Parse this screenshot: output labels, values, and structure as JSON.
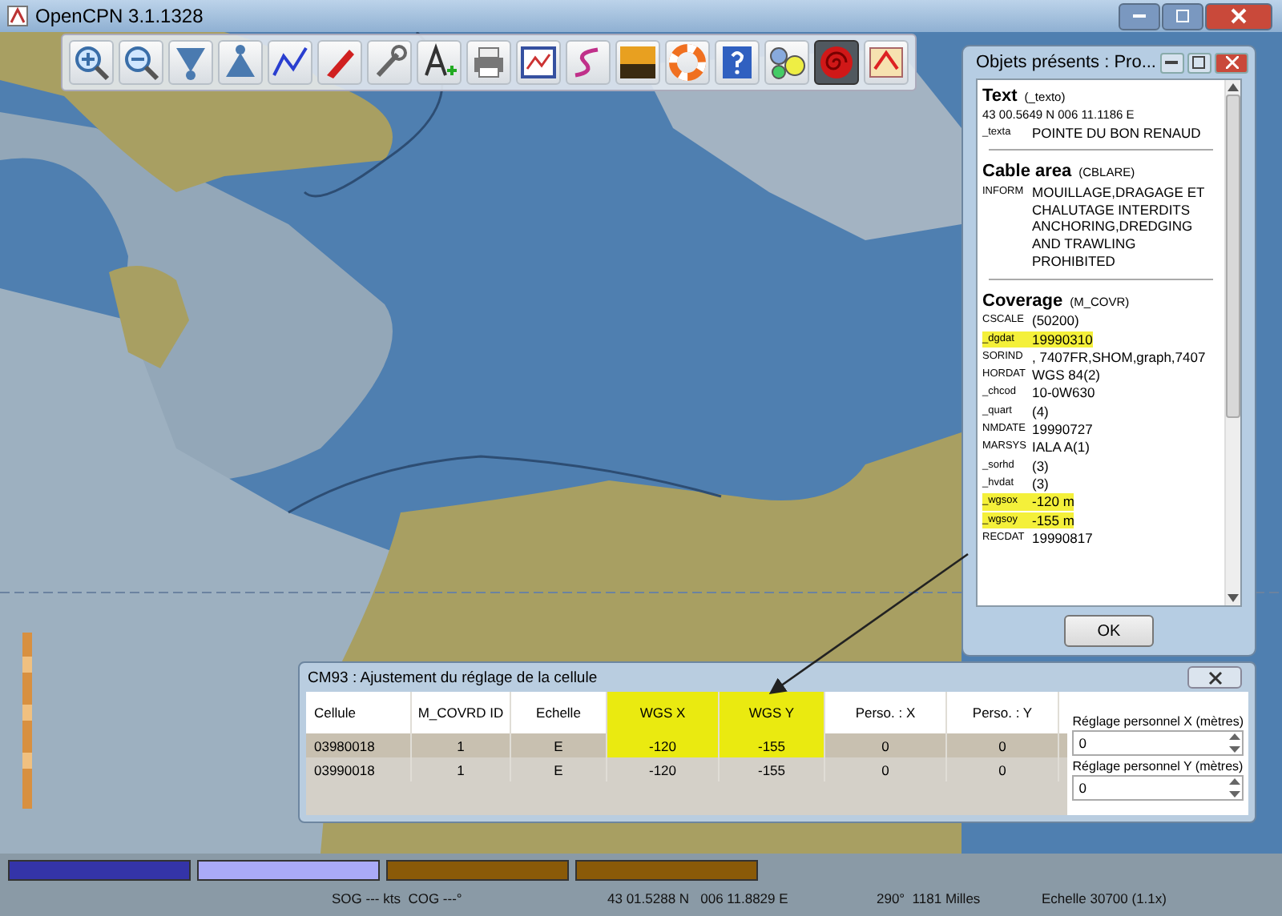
{
  "window": {
    "title": "OpenCPN 3.1.1328"
  },
  "toolbar": [
    {
      "selected": false
    },
    {
      "selected": false
    },
    {
      "selected": false
    },
    {
      "selected": false
    },
    {
      "selected": false
    },
    {
      "selected": false
    },
    {
      "selected": false
    },
    {
      "selected": false
    },
    {
      "selected": false
    },
    {
      "selected": false
    },
    {
      "selected": false
    },
    {
      "selected": false
    },
    {
      "selected": false
    },
    {
      "selected": false
    },
    {
      "selected": false
    },
    {
      "selected": true
    },
    {
      "selected": false
    }
  ],
  "objects_window": {
    "title": "Objets présents : Pro...",
    "sections": [
      {
        "name": "Text",
        "code": "(_texto)",
        "position": "43 00.5649 N 006 11.1186 E",
        "rows": [
          {
            "key": "_texta",
            "value": "POINTE DU BON RENAUD",
            "highlighted": false
          }
        ]
      },
      {
        "name": "Cable area",
        "code": "(CBLARE)",
        "rows": [
          {
            "key": "INFORM",
            "value": "MOUILLAGE,DRAGAGE ET CHALUTAGE INTERDITS ANCHORING,DREDGING AND TRAWLING PROHIBITED",
            "highlighted": false
          }
        ]
      },
      {
        "name": "Coverage",
        "code": "(M_COVR)",
        "rows": [
          {
            "key": "CSCALE",
            "value": "(50200)",
            "highlighted": false
          },
          {
            "key": "_dgdat",
            "value": "19990310",
            "highlighted": true
          },
          {
            "key": "SORIND",
            "value": ", 7407FR,SHOM,graph,7407",
            "highlighted": false
          },
          {
            "key": "HORDAT",
            "value": "WGS 84(2)",
            "highlighted": false
          },
          {
            "key": "_chcod",
            "value": "10-0W630",
            "highlighted": false
          },
          {
            "key": "_quart",
            "value": "(4)",
            "highlighted": false
          },
          {
            "key": "NMDATE",
            "value": "19990727",
            "highlighted": false
          },
          {
            "key": "MARSYS",
            "value": "IALA A(1)",
            "highlighted": false
          },
          {
            "key": "_sorhd",
            "value": "(3)",
            "highlighted": false
          },
          {
            "key": "_hvdat",
            "value": "(3)",
            "highlighted": false
          },
          {
            "key": "_wgsox",
            "value": "-120 m",
            "highlighted": true
          },
          {
            "key": "_wgsoy",
            "value": "-155 m",
            "highlighted": true
          },
          {
            "key": "RECDAT",
            "value": "19990817",
            "highlighted": false
          }
        ]
      }
    ],
    "ok_button": "OK"
  },
  "cell_dialog": {
    "title": "CM93 : Ajustement du réglage de la cellule",
    "columns": [
      {
        "label": "Cellule",
        "highlighted": false
      },
      {
        "label": "M_COVRD ID",
        "highlighted": false
      },
      {
        "label": "Echelle",
        "highlighted": false
      },
      {
        "label": "WGS X",
        "highlighted": true
      },
      {
        "label": "WGS Y",
        "highlighted": true
      },
      {
        "label": "Perso. : X",
        "highlighted": false
      },
      {
        "label": "Perso. : Y",
        "highlighted": false
      }
    ],
    "rows": [
      {
        "selected": true,
        "cells": [
          {
            "text": "03980018",
            "highlighted": false
          },
          {
            "text": "1",
            "highlighted": false
          },
          {
            "text": "E",
            "highlighted": false
          },
          {
            "text": "-120",
            "highlighted": true
          },
          {
            "text": "-155",
            "highlighted": true
          },
          {
            "text": "0",
            "highlighted": false
          },
          {
            "text": "0",
            "highlighted": false
          }
        ]
      },
      {
        "selected": false,
        "cells": [
          {
            "text": "03990018",
            "highlighted": false
          },
          {
            "text": "1",
            "highlighted": false
          },
          {
            "text": "E",
            "highlighted": false
          },
          {
            "text": "-120",
            "highlighted": false
          },
          {
            "text": "-155",
            "highlighted": false
          },
          {
            "text": "0",
            "highlighted": false
          },
          {
            "text": "0",
            "highlighted": false
          }
        ]
      }
    ],
    "fields": [
      {
        "label": "Réglage personnel X (mètres)",
        "value": "0"
      },
      {
        "label": "Réglage personnel Y (mètres)",
        "value": "0"
      }
    ]
  },
  "chart_bar": [
    {
      "color": "#3434a8"
    },
    {
      "color": "#aaaaf8"
    },
    {
      "color": "#8a5a08"
    },
    {
      "color": "#8a5a08"
    }
  ],
  "status_bar": {
    "speed": "SOG --- kts  COG ---°",
    "position": "43 01.5288 N   006 11.8829 E",
    "bearing": "290°  1181 Milles",
    "scale": "Echelle 30700 (1.1x)"
  }
}
